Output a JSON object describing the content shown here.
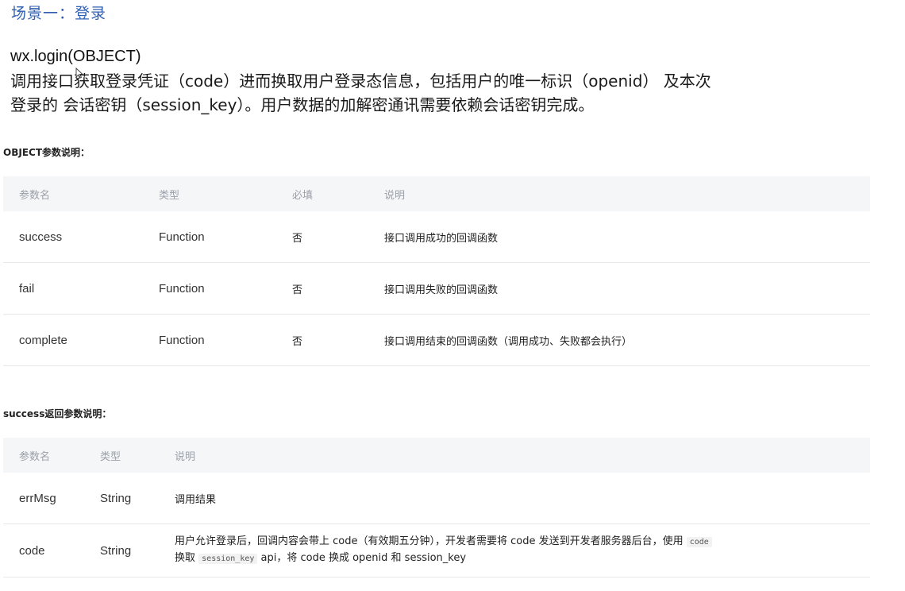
{
  "scene_title": "场景一：登录",
  "api": {
    "name": "wx.login(OBJECT)",
    "desc_line1": "调用接口获取登录凭证（code）进而换取用户登录态信息，包括用户的唯一标识（openid） 及本次",
    "desc_line2": "登录的 会话密钥（session_key）。用户数据的加解密通讯需要依赖会话密钥完成。"
  },
  "object_section": {
    "title": "OBJECT参数说明：",
    "headers": [
      "参数名",
      "类型",
      "必填",
      "说明"
    ],
    "rows": [
      {
        "name": "success",
        "type": "Function",
        "required": "否",
        "desc": "接口调用成功的回调函数"
      },
      {
        "name": "fail",
        "type": "Function",
        "required": "否",
        "desc": "接口调用失败的回调函数"
      },
      {
        "name": "complete",
        "type": "Function",
        "required": "否",
        "desc": "接口调用结束的回调函数（调用成功、失败都会执行）"
      }
    ]
  },
  "success_section": {
    "title": "success返回参数说明：",
    "headers": [
      "参数名",
      "类型",
      "说明"
    ],
    "rows": [
      {
        "name": "errMsg",
        "type": "String",
        "desc": "调用结果"
      },
      {
        "name": "code",
        "type": "String",
        "desc_part1": "用户允许登录后，回调内容会带上 code（有效期五分钟），开发者需要将 code 发送到开发者服务器后台，使用",
        "desc_code1": "code",
        "desc_part2": "换取",
        "desc_code2": "session_key",
        "desc_part3": " api，将 code 换成 openid 和 session_key"
      }
    ]
  },
  "cursor": {
    "icon": "mouse-pointer-icon"
  }
}
